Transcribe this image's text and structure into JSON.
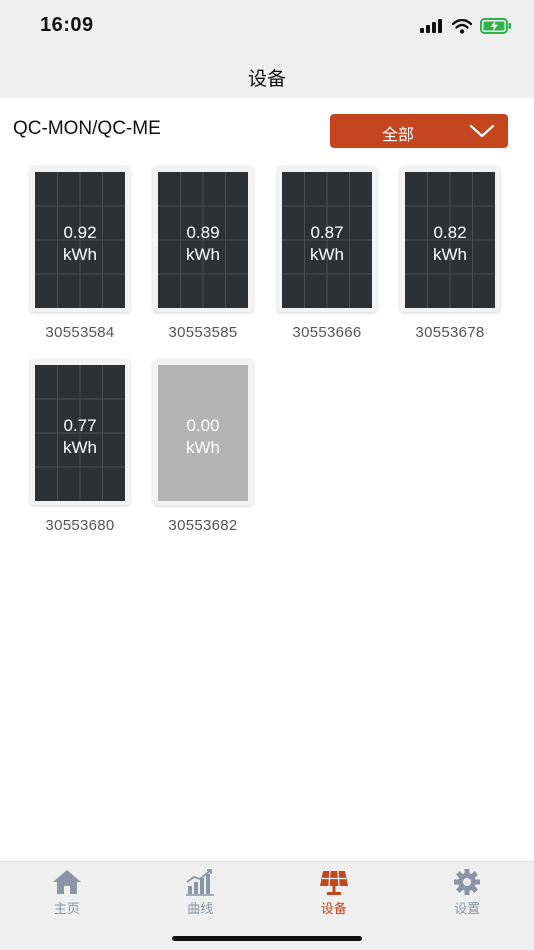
{
  "status_bar": {
    "time": "16:09"
  },
  "header": {
    "title": "设备"
  },
  "model": {
    "label": "QC-MON/QC-ME"
  },
  "filter": {
    "selected": "全部"
  },
  "devices": [
    {
      "value": "0.92",
      "unit": "kWh",
      "serial": "30553584",
      "online": true
    },
    {
      "value": "0.89",
      "unit": "kWh",
      "serial": "30553585",
      "online": true
    },
    {
      "value": "0.87",
      "unit": "kWh",
      "serial": "30553666",
      "online": true
    },
    {
      "value": "0.82",
      "unit": "kWh",
      "serial": "30553678",
      "online": true
    },
    {
      "value": "0.77",
      "unit": "kWh",
      "serial": "30553680",
      "online": true
    },
    {
      "value": "0.00",
      "unit": "kWh",
      "serial": "30553682",
      "online": false
    }
  ],
  "tabs": [
    {
      "label": "主页",
      "icon": "home-icon",
      "active": false
    },
    {
      "label": "曲线",
      "icon": "chart-icon",
      "active": false
    },
    {
      "label": "设备",
      "icon": "solar-panel-icon",
      "active": true
    },
    {
      "label": "设置",
      "icon": "gear-icon",
      "active": false
    }
  ],
  "colors": {
    "accent": "#c3461f",
    "panel": "#2e3134",
    "panel_offline": "#b4b4b4",
    "tab_inactive": "#8a96a6"
  }
}
